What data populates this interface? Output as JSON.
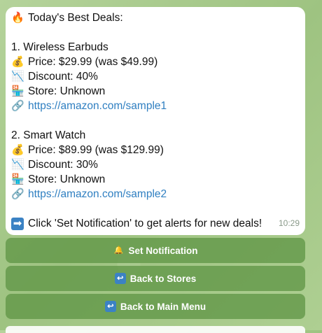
{
  "message": {
    "header": "Today's Best Deals:",
    "deals": [
      {
        "title": "1. Wireless Earbuds",
        "price": "Price: $29.99 (was $49.99)",
        "discount": "Discount: 40%",
        "store": "Store: Unknown",
        "link": "https://amazon.com/sample1"
      },
      {
        "title": "2. Smart Watch",
        "price": "Price: $89.99 (was $129.99)",
        "discount": "Discount: 30%",
        "store": "Store: Unknown",
        "link": "https://amazon.com/sample2"
      }
    ],
    "footer": "Click 'Set Notification' to get alerts for new deals!",
    "time": "10:29"
  },
  "icons": {
    "fire": "fire-icon",
    "money": "money-bag-icon",
    "chart": "chart-decreasing-icon",
    "store": "robot-store-icon",
    "link": "link-icon",
    "arrow": "right-arrow-icon",
    "bell": "bell-icon",
    "return": "return-arrow-icon"
  },
  "buttons": {
    "set_notification": "Set Notification",
    "back_to_stores": "Back to Stores",
    "back_to_main_menu": "Back to Main Menu"
  },
  "colors": {
    "link": "#2f7fc1",
    "button_bg": "#6a9a4e",
    "accent_blue": "#3b82c4"
  }
}
